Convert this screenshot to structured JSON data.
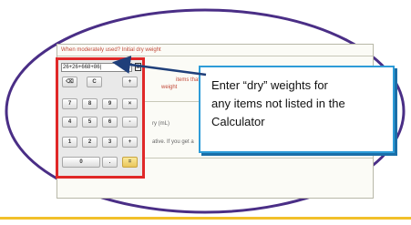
{
  "form": {
    "line1": "When moderately used? Initial dry weight",
    "line2": "items that are not on",
    "line3": "weight",
    "line4": "ry (mL)",
    "line5": "ative. If you get a"
  },
  "calculator": {
    "display": "26+26+668+86|",
    "icon_label": "▦",
    "buttons": {
      "backspace": "⌫",
      "clear": "C",
      "add": "+",
      "seven": "7",
      "eight": "8",
      "nine": "9",
      "multiply": "×",
      "four": "4",
      "five": "5",
      "six": "6",
      "subtract": "-",
      "one": "1",
      "two": "2",
      "three": "3",
      "plus2": "+",
      "zero": "0",
      "decimal": ".",
      "equals": "="
    }
  },
  "callout": {
    "line1": "Enter “dry” weights for",
    "line2": "any items not listed in the",
    "line3": "Calculator"
  },
  "colors": {
    "ellipse": "#4a2e86",
    "callout_border": "#2e9cd8",
    "calc_highlight": "#e02828",
    "bottom_rule": "#f2c02a"
  }
}
